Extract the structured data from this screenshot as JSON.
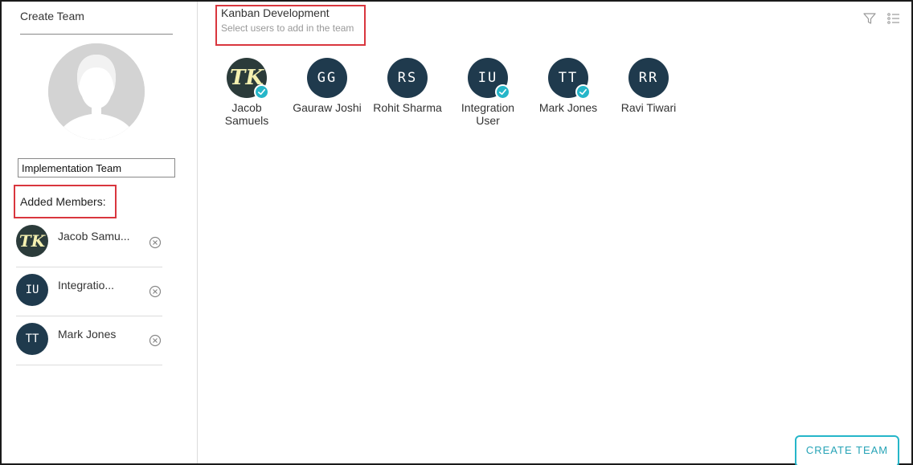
{
  "sidebar": {
    "title": "Create Team",
    "team_name_value": "Implementation Team",
    "added_members_label": "Added Members:",
    "members": [
      {
        "initials": "TK",
        "name": "Jacob Samu..."
      },
      {
        "initials": "IU",
        "name": "Integratio..."
      },
      {
        "initials": "TT",
        "name": "Mark Jones"
      }
    ]
  },
  "main": {
    "project_title": "Kanban Development",
    "subtitle": "Select users to add in the team",
    "users": [
      {
        "initials": "TK",
        "name": "Jacob Samuels",
        "selected": true
      },
      {
        "initials": "GG",
        "name": "Gauraw Joshi",
        "selected": false
      },
      {
        "initials": "RS",
        "name": "Rohit Sharma",
        "selected": false
      },
      {
        "initials": "IU",
        "name": "Integration User",
        "selected": true
      },
      {
        "initials": "TT",
        "name": "Mark Jones",
        "selected": true
      },
      {
        "initials": "RR",
        "name": "Ravi Tiwari",
        "selected": false
      }
    ],
    "create_button_label": "CREATE TEAM"
  },
  "icons": {
    "filter": "filter-icon",
    "list_view": "list-view-icon",
    "remove": "remove-circle-icon",
    "check": "check-icon",
    "team_placeholder": "person-silhouette-icon"
  },
  "colors": {
    "avatar_bg": "#1f3a4d",
    "accent": "#26b6c9",
    "highlight_box": "#d9363e"
  }
}
